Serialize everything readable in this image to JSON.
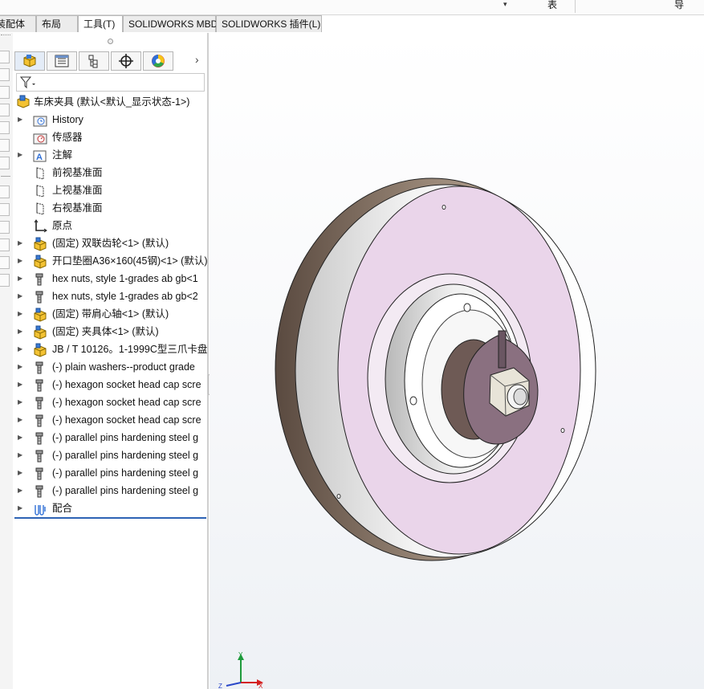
{
  "top_strip": {
    "dropdown_glyph": "▾",
    "label_1": "表",
    "label_2": "导"
  },
  "tabs": [
    "装配体",
    "布局",
    "工具(T)",
    "SOLIDWORKS MBD",
    "SOLIDWORKS 插件(L)"
  ],
  "active_tab": "工具(T)",
  "feature_manager": {
    "tabs": [
      "featuremanager-tree-icon",
      "propertymanager-icon",
      "configurationmanager-icon",
      "dimxpert-icon",
      "display-manager-icon"
    ],
    "expand_chevron": "›",
    "filter_icon": "funnel-icon",
    "root": "车床夹具  (默认<默认_显示状态-1>)",
    "items": [
      {
        "label": "History",
        "icon": "history-folder-icon",
        "expandable": true
      },
      {
        "label": "传感器",
        "icon": "sensor-folder-icon",
        "expandable": false
      },
      {
        "label": "注解",
        "icon": "annotations-icon",
        "expandable": true
      },
      {
        "label": "前视基准面",
        "icon": "plane-icon",
        "expandable": false
      },
      {
        "label": "上视基准面",
        "icon": "plane-icon",
        "expandable": false
      },
      {
        "label": "右视基准面",
        "icon": "plane-icon",
        "expandable": false
      },
      {
        "label": "原点",
        "icon": "origin-icon",
        "expandable": false
      },
      {
        "label": "(固定) 双联齿轮<1> (默认)",
        "icon": "subassembly-icon",
        "expandable": true
      },
      {
        "label": "开口垫圈A36×160(45钢)<1> (默认)",
        "icon": "subassembly-icon",
        "expandable": true
      },
      {
        "label": "hex nuts, style 1-grades ab gb<1",
        "icon": "toolbox-part-icon",
        "expandable": true
      },
      {
        "label": "hex nuts, style 1-grades ab gb<2",
        "icon": "toolbox-part-icon",
        "expandable": true
      },
      {
        "label": "(固定) 带肩心轴<1> (默认)",
        "icon": "subassembly-icon",
        "expandable": true
      },
      {
        "label": "(固定) 夹具体<1> (默认)",
        "icon": "subassembly-icon",
        "expandable": true
      },
      {
        "label": "JB / T 10126。1-1999C型三爪卡盘",
        "icon": "subassembly-icon",
        "expandable": true
      },
      {
        "label": "(-) plain washers--product grade",
        "icon": "toolbox-part-icon",
        "expandable": true
      },
      {
        "label": "(-) hexagon socket head cap scre",
        "icon": "toolbox-part-icon",
        "expandable": true
      },
      {
        "label": "(-) hexagon socket head cap scre",
        "icon": "toolbox-part-icon",
        "expandable": true
      },
      {
        "label": "(-) hexagon socket head cap scre",
        "icon": "toolbox-part-icon",
        "expandable": true
      },
      {
        "label": "(-) parallel pins hardening steel g",
        "icon": "toolbox-part-icon",
        "expandable": true
      },
      {
        "label": "(-) parallel pins hardening steel g",
        "icon": "toolbox-part-icon",
        "expandable": true
      },
      {
        "label": "(-) parallel pins hardening steel g",
        "icon": "toolbox-part-icon",
        "expandable": true
      },
      {
        "label": "(-) parallel pins hardening steel g",
        "icon": "toolbox-part-icon",
        "expandable": true
      },
      {
        "label": "配合",
        "icon": "mates-icon",
        "expandable": true
      }
    ]
  },
  "colors": {
    "face": "#ead5ea",
    "rim": "#7a6a5e",
    "accent": "#2e63b5",
    "hex_nut": "#e8e4d8"
  },
  "triad": {
    "x": "X",
    "y": "Y",
    "z": "Z"
  }
}
